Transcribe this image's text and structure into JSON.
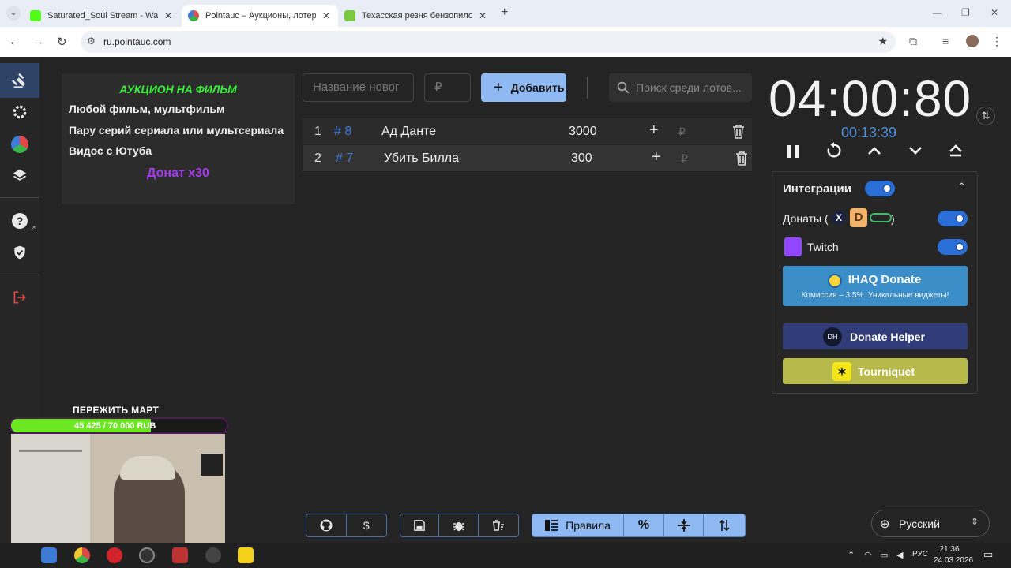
{
  "browser": {
    "tabs": [
      {
        "title": "Saturated_Soul Stream - Watch",
        "favicon_color": "#53fc18",
        "active": false
      },
      {
        "title": "Pointauc – Аукционы, лотереи",
        "favicon_color": "#d9534f",
        "active": true
      },
      {
        "title": "Техасская резня бензопилой (",
        "favicon_color": "#7ac943",
        "active": false
      }
    ],
    "url": "ru.pointauc.com"
  },
  "rules_card": {
    "title": "АУКЦИОН НА ФИЛЬМ",
    "lines": [
      "Любой фильм, мультфильм",
      "Пару серий сериала или мультсериала",
      "Видос с Ютуба"
    ],
    "donate": "Донат х30"
  },
  "lot_form": {
    "name_placeholder": "Название новог",
    "amount_placeholder": "₽",
    "add_label": "Добавить",
    "search_placeholder": "Поиск среди лотов..."
  },
  "lots": [
    {
      "index": "1",
      "id": "# 8",
      "name": "Ад Данте",
      "amount": "3000"
    },
    {
      "index": "2",
      "id": "# 7",
      "name": "Убить Билла",
      "amount": "300"
    }
  ],
  "timer": {
    "main": "04:00:80",
    "sub": "00:13:39"
  },
  "integrations": {
    "title": "Интеграции",
    "donations_label": "Донаты (",
    "donations_close": ")",
    "twitch_label": "Twitch",
    "ihaq_title": "IHAQ Donate",
    "ihaq_sub": "Комиссия – 3,5%. Уникальные виджеты!",
    "donate_helper": "Donate Helper",
    "donate_helper_icon": "DH",
    "tourniquet": "Tourniquet"
  },
  "toolbar": {
    "rules_label": "Правила",
    "percent_label": "%"
  },
  "language": {
    "selected": "Русский"
  },
  "stream_overlay": {
    "goal_title": "ПЕРЕЖИТЬ МАРТ",
    "goal_text": "45 425 / 70 000 RUB",
    "goal_progress": 0.649
  },
  "taskbar": {
    "lang": "РУС",
    "time": "21:36",
    "date": "24.03.2026"
  },
  "colors": {
    "accent": "#8fb9f3",
    "green_title": "#39f039",
    "purple_donate": "#a33ce8",
    "lot_id_blue": "#3d7ad6"
  }
}
